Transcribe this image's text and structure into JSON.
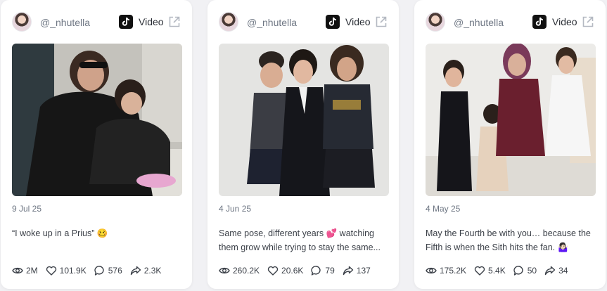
{
  "cards": [
    {
      "username": "@_nhutella",
      "platform": "Video",
      "date": "9 Jul 25",
      "caption": "“I woke up in a Prius” 🥴",
      "stats": {
        "views": "2M",
        "likes": "101.9K",
        "comments": "576",
        "shares": "2.3K"
      }
    },
    {
      "username": "@_nhutella",
      "platform": "Video",
      "date": "4 Jun 25",
      "caption": "Same pose, different years 💕 watching them grow while trying to stay the same...",
      "stats": {
        "views": "260.2K",
        "likes": "20.6K",
        "comments": "79",
        "shares": "137"
      }
    },
    {
      "username": "@_nhutella",
      "platform": "Video",
      "date": "4 May 25",
      "caption": "May the Fourth be with you… because the Fifth is when the Sith hits the fan. 🤷🏻‍♀️",
      "stats": {
        "views": "175.2K",
        "likes": "5.4K",
        "comments": "50",
        "shares": "34"
      }
    }
  ]
}
